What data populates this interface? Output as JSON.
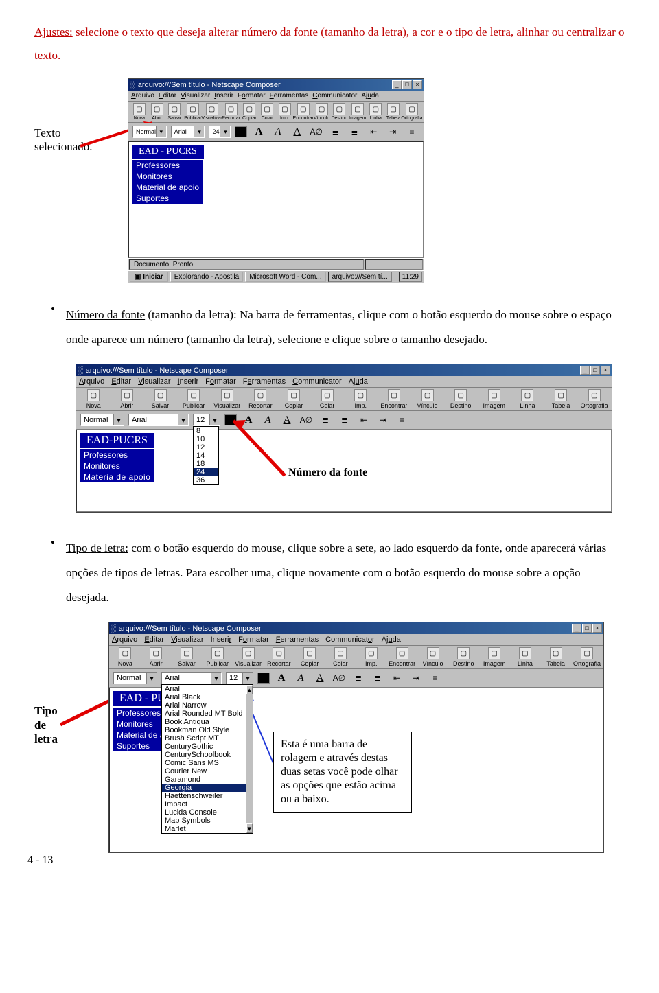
{
  "heading_prefix": "Ajustes:",
  "heading_rest": " selecione o texto que deseja alterar número da fonte (tamanho da letra), a cor e o tipo de letra, alinhar ou centralizar o texto.",
  "label_texto_selecionado": "Texto selecionado.",
  "bullet1_lead": "Número da fonte",
  "bullet1_text": " (tamanho da letra): Na barra de ferramentas, clique com o botão esquerdo do mouse sobre o espaço onde aparece um número (tamanho da letra), selecione e clique sobre o tamanho desejado.",
  "bullet2_lead": "Tipo de letra:",
  "bullet2_text": " com o botão esquerdo do mouse, clique sobre a sete, ao lado esquerdo da fonte, onde aparecerá várias opções de tipos de letras. Para escolher uma, clique novamente com o botão esquerdo do mouse sobre a opção desejada.",
  "label_numero_fonte": "Número da fonte",
  "label_tipo_letra_a": "Tipo",
  "label_tipo_letra_b": "de",
  "label_tipo_letra_c": "letra",
  "callout_scroll": "Esta é uma barra de rolagem e através destas duas setas você pode olhar as opções que estão acima ou a baixo.",
  "page_number": "4 - 13",
  "composer": {
    "title": "arquivo:///Sem título - Netscape Composer",
    "menus": [
      "Arquivo",
      "Editar",
      "Visualizar",
      "Inserir",
      "Formatar",
      "Ferramentas",
      "Communicator",
      "Ajuda"
    ],
    "toolbar_buttons": [
      "Nova",
      "Abrir",
      "Salvar",
      "Publicar",
      "Visualizar",
      "Recortar",
      "Copiar",
      "Colar",
      "Imp.",
      "Encontrar",
      "Vínculo",
      "Destino",
      "Imagem",
      "Linha",
      "Tabela",
      "Ortografia"
    ],
    "style_sel": "Normal",
    "font_sel": "Arial",
    "size_sel": "12",
    "size_sel_2": "24",
    "size_options": [
      "8",
      "10",
      "12",
      "14",
      "18",
      "24",
      "36"
    ],
    "font_options": [
      "Arial",
      "Arial Black",
      "Arial Narrow",
      "Arial Rounded MT Bold",
      "Book Antiqua",
      "Bookman Old Style",
      "Brush Script MT",
      "CenturyGothic",
      "CenturySchoolbook",
      "Comic Sans MS",
      "Courier New",
      "Garamond",
      "Georgia",
      "Haettenschweiler",
      "Impact",
      "Lucida Console",
      "Map Symbols",
      "Marlet"
    ],
    "doc_title": "EAD - PUCRS",
    "doc_title_2": "EAD-PUCRS",
    "doc_title_3": "EAD - PUCF",
    "side_items": [
      "Professores",
      "Monitores",
      "Material de apoio",
      "Suportes"
    ],
    "side_items_3": [
      "Professores",
      "Monitores",
      "Material de a",
      "Suportes"
    ],
    "status_text": "Documento: Pronto",
    "taskbar_start": "Iniciar",
    "taskbar_items": [
      "Explorando - Apostila",
      "Microsoft Word - Com...",
      "arquivo:///Sem tí..."
    ],
    "clock": "11:29"
  }
}
